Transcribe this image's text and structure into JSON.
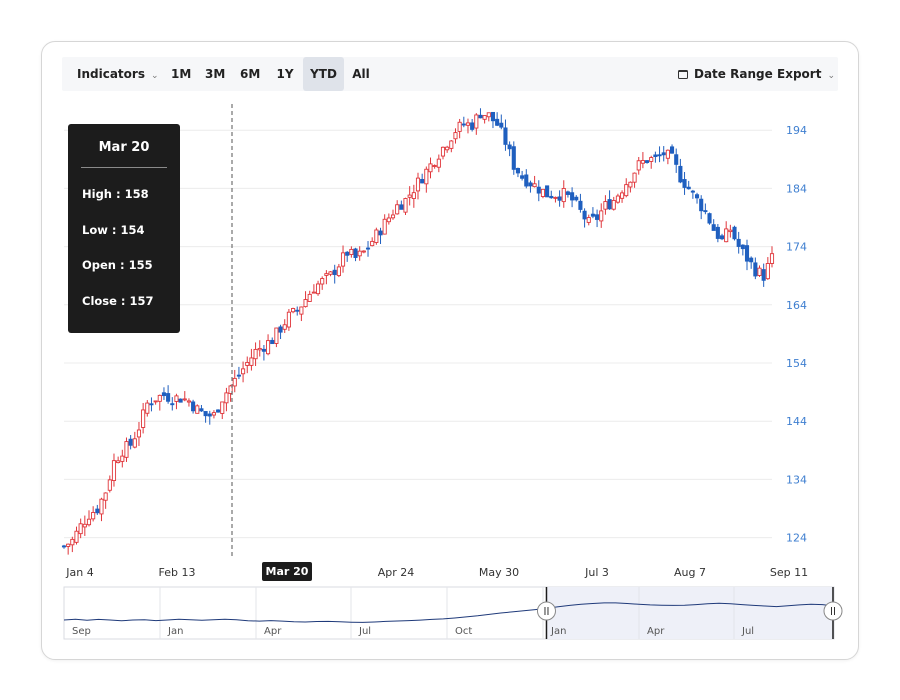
{
  "toolbar": {
    "indicators_label": "Indicators",
    "ranges": [
      "1M",
      "3M",
      "6M",
      "1Y",
      "YTD",
      "All"
    ],
    "active_range": "YTD",
    "date_range_label": "Date Range",
    "export_label": "Export"
  },
  "tooltip": {
    "date": "Mar 20",
    "high": "High : 158",
    "low": "Low : 154",
    "open": "Open : 155",
    "close": "Close : 157"
  },
  "crosshair_label": "Mar 20",
  "colors": {
    "bull": "#e0353a",
    "bear": "#1f5fbf",
    "axis_text": "#3f7fd0",
    "navigator_line": "#1f3a7a",
    "navigator_fill": "#eef0f8"
  },
  "chart_data": {
    "type": "candlestick",
    "y_ticks": [
      124,
      134,
      144,
      154,
      164,
      174,
      184,
      194
    ],
    "ylim": [
      120.5,
      198.5
    ],
    "x_labels": [
      "Jan 4",
      "Feb 13",
      "Mar 20",
      "Apr 24",
      "May 30",
      "Jul 3",
      "Aug 7",
      "Sep 11"
    ],
    "grid": true,
    "crosshair_at": "Mar 20",
    "close_path": [
      [
        0,
        122.5
      ],
      [
        4,
        123.5
      ],
      [
        8,
        126
      ],
      [
        12,
        128
      ],
      [
        16,
        129
      ],
      [
        20,
        132
      ],
      [
        24,
        137
      ],
      [
        28,
        139
      ],
      [
        32,
        140
      ],
      [
        36,
        143
      ],
      [
        40,
        147
      ],
      [
        44,
        148
      ],
      [
        48,
        148.5
      ],
      [
        52,
        148
      ],
      [
        56,
        148
      ],
      [
        60,
        147.5
      ],
      [
        64,
        146
      ],
      [
        68,
        145
      ],
      [
        72,
        145
      ],
      [
        76,
        148
      ],
      [
        80,
        150
      ],
      [
        84,
        152
      ],
      [
        88,
        154
      ],
      [
        92,
        156
      ],
      [
        96,
        157
      ],
      [
        100,
        158
      ],
      [
        104,
        160
      ],
      [
        108,
        162
      ],
      [
        112,
        163
      ],
      [
        116,
        165
      ],
      [
        120,
        167
      ],
      [
        124,
        168
      ],
      [
        128,
        169
      ],
      [
        132,
        171
      ],
      [
        136,
        173
      ],
      [
        140,
        172
      ],
      [
        144,
        173
      ],
      [
        148,
        175
      ],
      [
        152,
        177
      ],
      [
        156,
        179
      ],
      [
        160,
        181
      ],
      [
        164,
        182
      ],
      [
        168,
        184
      ],
      [
        172,
        186
      ],
      [
        176,
        188
      ],
      [
        180,
        190
      ],
      [
        184,
        192
      ],
      [
        188,
        194
      ],
      [
        192,
        195
      ],
      [
        196,
        195
      ],
      [
        200,
        197
      ],
      [
        204,
        196.5
      ],
      [
        208,
        195
      ],
      [
        212,
        192
      ],
      [
        216,
        188
      ],
      [
        220,
        186
      ],
      [
        224,
        185
      ],
      [
        228,
        184
      ],
      [
        232,
        183
      ],
      [
        236,
        183
      ],
      [
        240,
        183
      ],
      [
        244,
        182
      ],
      [
        248,
        180
      ],
      [
        252,
        178
      ],
      [
        256,
        179
      ],
      [
        260,
        181
      ],
      [
        264,
        182
      ],
      [
        268,
        184
      ],
      [
        272,
        186
      ],
      [
        276,
        188
      ],
      [
        280,
        189
      ],
      [
        284,
        189
      ],
      [
        288,
        190
      ],
      [
        292,
        189
      ],
      [
        296,
        186
      ],
      [
        300,
        184
      ],
      [
        304,
        182
      ],
      [
        308,
        180
      ],
      [
        312,
        177
      ],
      [
        316,
        175
      ],
      [
        320,
        177
      ],
      [
        324,
        174
      ],
      [
        328,
        172
      ],
      [
        332,
        170
      ],
      [
        336,
        169
      ],
      [
        340,
        172
      ]
    ],
    "x_domain": [
      0,
      340
    ]
  },
  "navigator": {
    "labels": [
      "Sep",
      "Jan",
      "Apr",
      "Jul",
      "Oct",
      "Jan",
      "Apr",
      "Jul"
    ],
    "selection_start": 0.6266,
    "selection_end": 1.0,
    "series": [
      5,
      5.5,
      4.8,
      5.4,
      5,
      4.4,
      5,
      5.2,
      4.6,
      5,
      5.6,
      5.2,
      4.8,
      5.2,
      5.6,
      5.2,
      4.5,
      4.2,
      4.6,
      4.2,
      3.8,
      3.6,
      3.9,
      4,
      3.7,
      3.4,
      3.3,
      3.6,
      4,
      4.3,
      4.6,
      4.9,
      5.4,
      5.8,
      6.4,
      7.2,
      8,
      9,
      10,
      10.8,
      11.6,
      12.4,
      13.4,
      14.4,
      15.4,
      16.2,
      16.8,
      17.2,
      17.2,
      16.8,
      16.2,
      15.8,
      15.6,
      15.4,
      15.6,
      16,
      16.6,
      17,
      16.6,
      16,
      15.4,
      15,
      14.6,
      15.2,
      15.8,
      16.2,
      16,
      15
    ]
  }
}
